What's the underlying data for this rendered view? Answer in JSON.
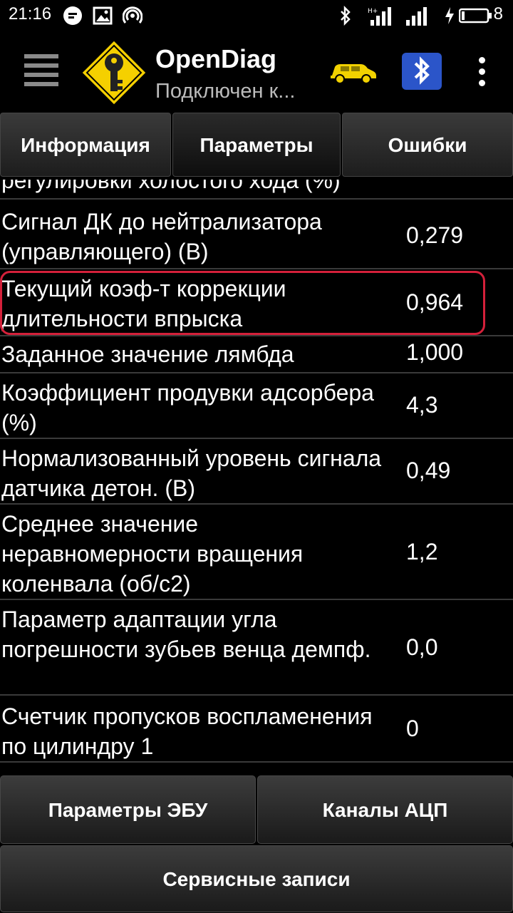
{
  "status_bar": {
    "time": "21:16",
    "battery_level": "8",
    "network_label": "H+"
  },
  "app_bar": {
    "title": "OpenDiag",
    "subtitle": "Подключен к..."
  },
  "tabs": [
    {
      "label": "Информация",
      "active": false
    },
    {
      "label": "Параметры",
      "active": true
    },
    {
      "label": "Ошибки",
      "active": false
    }
  ],
  "partial_row": {
    "label": "регулировки холостого хода (%)"
  },
  "rows": [
    {
      "label": "Сигнал ДК до нейтрализатора (управляющего) (В)",
      "value": "0,279"
    },
    {
      "label": "Текущий коэф-т коррекции длительности впрыска",
      "value": "0,964",
      "highlighted": true
    },
    {
      "label": "Заданное значение лямбда",
      "value": "1,000"
    },
    {
      "label": "Коэффициент продувки адсорбера (%)",
      "value": "4,3"
    },
    {
      "label": "Нормализованный уровень сигнала датчика детон. (В)",
      "value": "0,49"
    },
    {
      "label": "Среднее значение неравномерности вращения коленвала (об/с2)",
      "value": "1,2"
    },
    {
      "label": "Параметр адаптации угла погрешности зубьев венца демпф.",
      "value": "0,0"
    },
    {
      "label": "Счетчик пропусков воспламенения по цилиндру 1",
      "value": "0"
    }
  ],
  "bottom_buttons": {
    "ecu_params": "Параметры ЭБУ",
    "adc_channels": "Каналы АЦП",
    "service_records": "Сервисные записи"
  },
  "colors": {
    "background": "#000000",
    "highlight_border": "#d4203a",
    "car_icon": "#f2d200",
    "logo_yellow": "#f5d000"
  }
}
